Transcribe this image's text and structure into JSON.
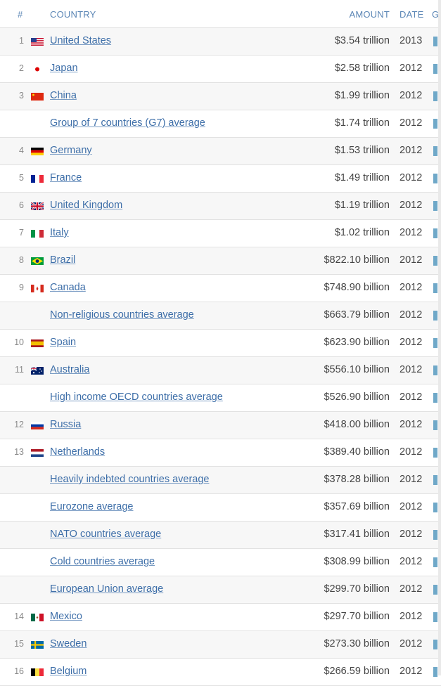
{
  "header": {
    "rank": "#",
    "country": "COUNTRY",
    "amount": "AMOUNT",
    "date": "DATE",
    "graph": "G"
  },
  "rows": [
    {
      "rank": "1",
      "flag": "us",
      "name": "United States",
      "amount": "$3.54 trillion",
      "date": "2013"
    },
    {
      "rank": "2",
      "flag": "jp",
      "name": "Japan",
      "amount": "$2.58 trillion",
      "date": "2012"
    },
    {
      "rank": "3",
      "flag": "cn",
      "name": "China",
      "amount": "$1.99 trillion",
      "date": "2012"
    },
    {
      "rank": "",
      "flag": "",
      "name": "Group of 7 countries (G7) average",
      "amount": "$1.74 trillion",
      "date": "2012"
    },
    {
      "rank": "4",
      "flag": "de",
      "name": "Germany",
      "amount": "$1.53 trillion",
      "date": "2012"
    },
    {
      "rank": "5",
      "flag": "fr",
      "name": "France",
      "amount": "$1.49 trillion",
      "date": "2012"
    },
    {
      "rank": "6",
      "flag": "gb",
      "name": "United Kingdom",
      "amount": "$1.19 trillion",
      "date": "2012"
    },
    {
      "rank": "7",
      "flag": "it",
      "name": "Italy",
      "amount": "$1.02 trillion",
      "date": "2012"
    },
    {
      "rank": "8",
      "flag": "br",
      "name": "Brazil",
      "amount": "$822.10 billion",
      "date": "2012"
    },
    {
      "rank": "9",
      "flag": "ca",
      "name": "Canada",
      "amount": "$748.90 billion",
      "date": "2012"
    },
    {
      "rank": "",
      "flag": "",
      "name": "Non-religious countries average",
      "amount": "$663.79 billion",
      "date": "2012"
    },
    {
      "rank": "10",
      "flag": "es",
      "name": "Spain",
      "amount": "$623.90 billion",
      "date": "2012"
    },
    {
      "rank": "11",
      "flag": "au",
      "name": "Australia",
      "amount": "$556.10 billion",
      "date": "2012"
    },
    {
      "rank": "",
      "flag": "",
      "name": "High income OECD countries average",
      "amount": "$526.90 billion",
      "date": "2012"
    },
    {
      "rank": "12",
      "flag": "ru",
      "name": "Russia",
      "amount": "$418.00 billion",
      "date": "2012"
    },
    {
      "rank": "13",
      "flag": "nl",
      "name": "Netherlands",
      "amount": "$389.40 billion",
      "date": "2012"
    },
    {
      "rank": "",
      "flag": "",
      "name": "Heavily indebted countries average",
      "amount": "$378.28 billion",
      "date": "2012"
    },
    {
      "rank": "",
      "flag": "",
      "name": "Eurozone average",
      "amount": "$357.69 billion",
      "date": "2012"
    },
    {
      "rank": "",
      "flag": "",
      "name": "NATO countries average",
      "amount": "$317.41 billion",
      "date": "2012"
    },
    {
      "rank": "",
      "flag": "",
      "name": "Cold countries average",
      "amount": "$308.99 billion",
      "date": "2012"
    },
    {
      "rank": "",
      "flag": "",
      "name": "European Union average",
      "amount": "$299.70 billion",
      "date": "2012"
    },
    {
      "rank": "14",
      "flag": "mx",
      "name": "Mexico",
      "amount": "$297.70 billion",
      "date": "2012"
    },
    {
      "rank": "15",
      "flag": "se",
      "name": "Sweden",
      "amount": "$273.30 billion",
      "date": "2012"
    },
    {
      "rank": "16",
      "flag": "be",
      "name": "Belgium",
      "amount": "$266.59 billion",
      "date": "2012"
    }
  ],
  "colors": {
    "link": "#3d6ea8",
    "header": "#5b86b5",
    "bar": "#6fa8c8"
  }
}
